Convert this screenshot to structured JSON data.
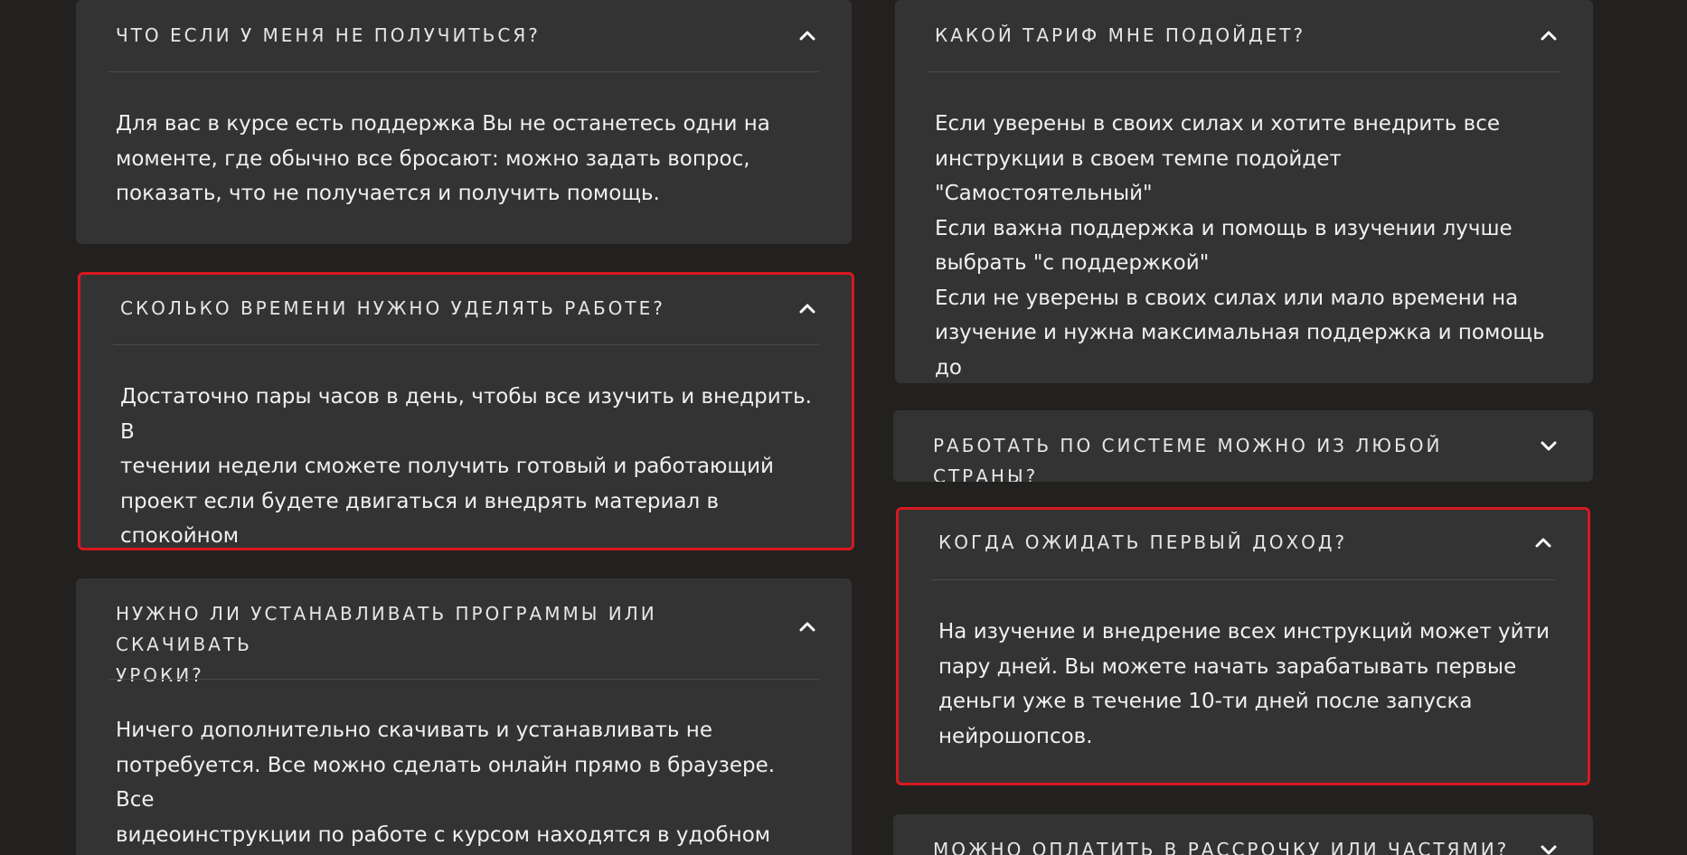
{
  "faq": {
    "q1": {
      "question": "Что если у меня не получиться?",
      "answer": "Для вас в курсе есть поддержка Вы не останетесь одни на\nмоменте, где обычно все бросают: можно задать вопрос,\nпоказать, что не получается и получить помощь."
    },
    "q2": {
      "question": "Сколько времени нужно уделять работе?",
      "answer": "Достаточно пары часов в день, чтобы все изучить и внедрить. В\nтечении недели сможете получить готовый и работающий\nпроект если будете двигаться и внедрять материал в спокойном\nтемпе."
    },
    "q3": {
      "question": "Нужно ли устанавливать программы или скачивать\nуроки?",
      "answer": "Ничего дополнительно скачивать и устанавливать не\nпотребуется. Все можно сделать онлайн прямо в браузере. Все\nвидеоинструкции по работе с курсом находятся в удобном\nонлайн  кабинете."
    },
    "q4": {
      "question": "Какой тариф мне подойдет?",
      "answer": "Если уверены в своих силах и хотите внедрить все\nинструкции в своем темпе подойдет \"Самостоятельный\"\nЕсли важна поддержка и помощь в изучении лучше\nвыбрать \"с поддержкой\"\nЕсли не уверены в своих силах или мало времени на\nизучение и нужна максимальная поддержка и помощь до\nрезультата выбирайте \"Запуск под ключ\""
    },
    "q5": {
      "question": "Работать по системе можно из любой страны?"
    },
    "q6": {
      "question": "Когда ожидать первый доход?",
      "answer": "На изучение и внедрение  всех инструкций может уйти\nпару дней. Вы можете начать зарабатывать первые\nденьги уже в течение 10-ти дней после запуска\nнейрошопсов."
    },
    "q7": {
      "question": "Можно оплатить в рассрочку или частями?"
    }
  },
  "colors": {
    "background": "#23211f",
    "card": "#333333",
    "highlight": "#d7181f"
  },
  "icons": {
    "expanded": "chevron-up-icon",
    "collapsed": "chevron-down-icon"
  }
}
